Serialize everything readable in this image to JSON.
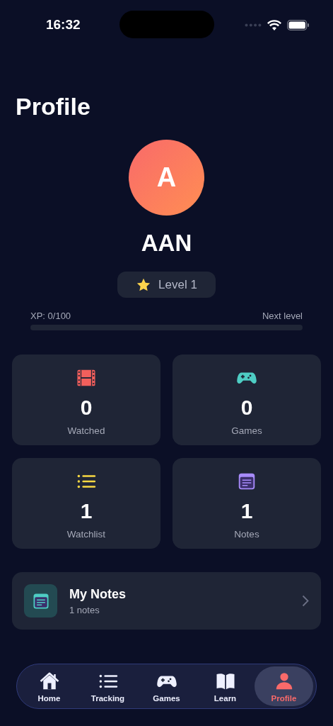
{
  "status_bar": {
    "time": "16:32"
  },
  "title": "Profile",
  "profile": {
    "initial": "A",
    "name": "AAN",
    "level_badge": "Level 1"
  },
  "xp": {
    "label": "XP: 0/100",
    "next": "Next level",
    "level": 0
  },
  "stats": [
    {
      "kind": "film",
      "value": "0",
      "label": "Watched",
      "color": "#f25f5c"
    },
    {
      "kind": "gamepad",
      "value": "0",
      "label": "Games",
      "color": "#4ecdc4"
    },
    {
      "kind": "list",
      "value": "1",
      "label": "Watchlist",
      "color": "#f7d842"
    },
    {
      "kind": "notes",
      "value": "1",
      "label": "Notes",
      "color": "#a78bfa"
    }
  ],
  "notes_row": {
    "title": "My Notes",
    "subtitle": "1 notes"
  },
  "tabs": [
    {
      "kind": "home",
      "label": "Home",
      "selected": false
    },
    {
      "kind": "list",
      "label": "Tracking",
      "selected": false
    },
    {
      "kind": "gamepad",
      "label": "Games",
      "selected": false
    },
    {
      "kind": "book",
      "label": "Learn",
      "selected": false
    },
    {
      "kind": "person",
      "label": "Profile",
      "selected": true
    }
  ]
}
